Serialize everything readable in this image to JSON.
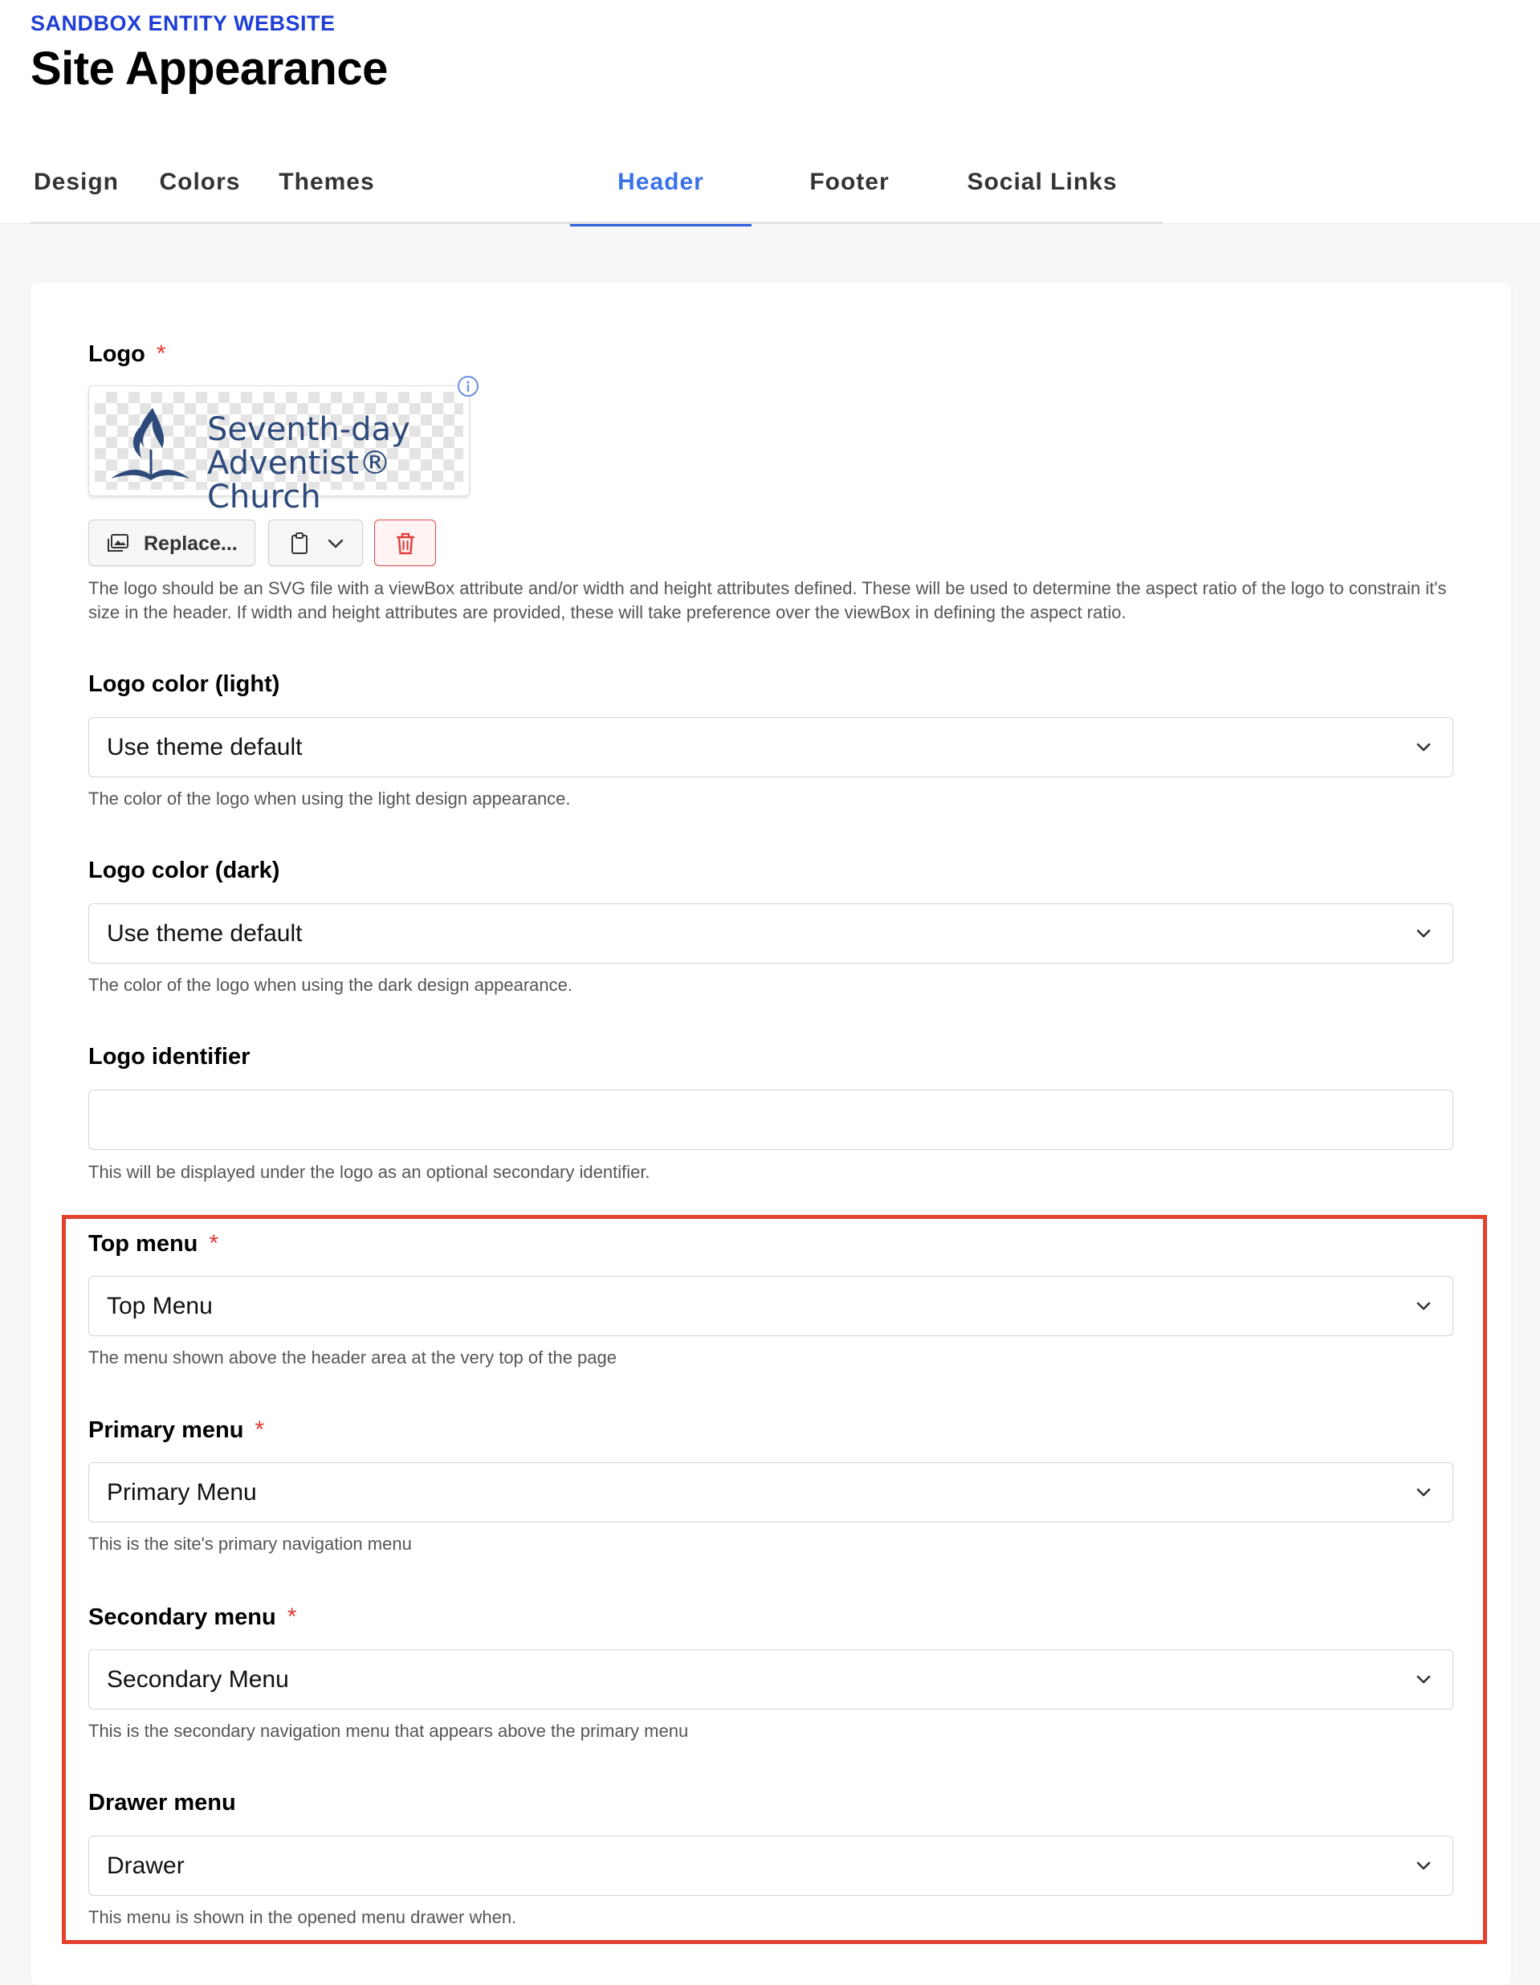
{
  "header": {
    "eyebrow": "SANDBOX ENTITY WEBSITE",
    "title": "Site Appearance"
  },
  "tabs": [
    {
      "label": "Design"
    },
    {
      "label": "Colors"
    },
    {
      "label": "Themes"
    },
    {
      "label": "Header",
      "active": true
    },
    {
      "label": "Footer"
    },
    {
      "label": "Social Links"
    }
  ],
  "logo": {
    "label": "Logo",
    "required_mark": "*",
    "image_text_line1": "Seventh-day",
    "image_text_line2": "Adventist® Church",
    "replace_label": "Replace...",
    "help": "The logo should be an SVG file with a viewBox attribute and/or width and height attributes defined. These will be used to determine the aspect ratio of the logo to constrain it's size in the header. If width and height attributes are provided, these will take preference over the viewBox in defining the aspect ratio.",
    "icons": [
      "info-icon",
      "image-icon",
      "clipboard-icon",
      "chevron-down-icon",
      "trash-icon"
    ]
  },
  "logo_color_light": {
    "label": "Logo color (light)",
    "value": "Use theme default",
    "help": "The color of the logo when using the light design appearance."
  },
  "logo_color_dark": {
    "label": "Logo color (dark)",
    "value": "Use theme default",
    "help": "The color of the logo when using the dark design appearance."
  },
  "logo_identifier": {
    "label": "Logo identifier",
    "value": "",
    "help": "This will be displayed under the logo as an optional secondary identifier."
  },
  "top_menu": {
    "label": "Top menu",
    "required_mark": "*",
    "value": "Top Menu",
    "help": "The menu shown above the header area at the very top of the page"
  },
  "primary_menu": {
    "label": "Primary menu",
    "required_mark": "*",
    "value": "Primary Menu",
    "help": "This is the site's primary navigation menu"
  },
  "secondary_menu": {
    "label": "Secondary menu",
    "required_mark": "*",
    "value": "Secondary Menu",
    "help": "This is the secondary navigation menu that appears above the primary menu"
  },
  "drawer_menu": {
    "label": "Drawer menu",
    "value": "Drawer",
    "help": "This menu is shown in the opened menu drawer when."
  },
  "colors": {
    "accent": "#3a72e8",
    "eyebrow": "#1f3fd6",
    "required": "#e53935",
    "highlight_border": "#e2412e",
    "logo_text": "#2d4a7b"
  }
}
